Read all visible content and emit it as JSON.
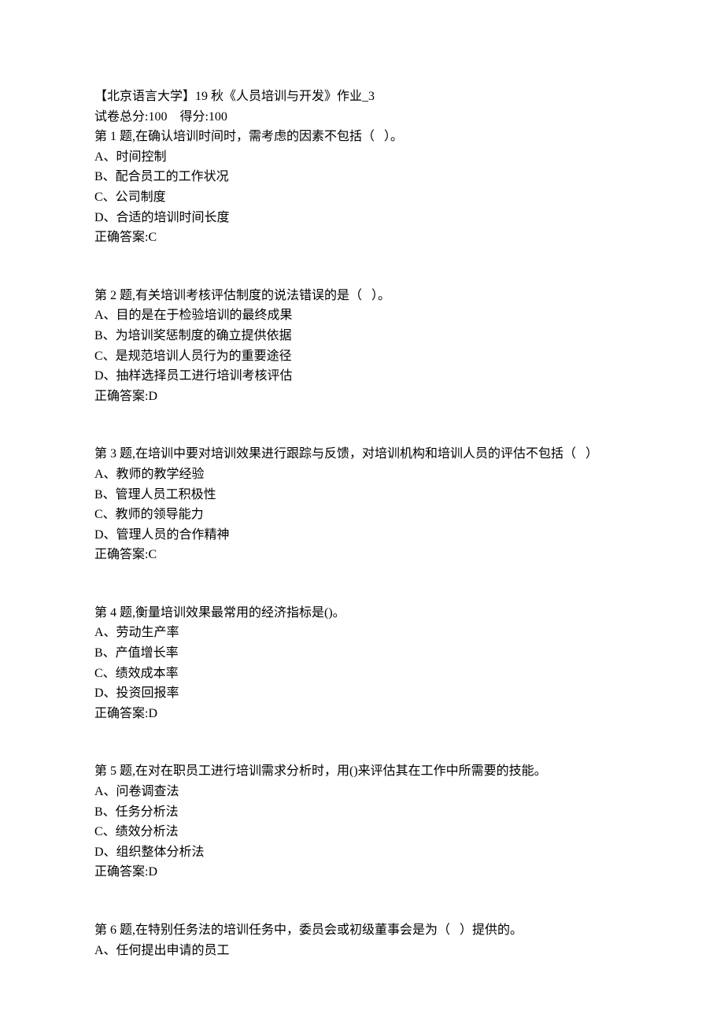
{
  "header": {
    "title_line": "【北京语言大学】19 秋《人员培训与开发》作业_3",
    "score_line": "试卷总分:100    得分:100"
  },
  "questions": [
    {
      "stem": "第 1 题,在确认培训时间时，需考虑的因素不包括（   ）。",
      "options": [
        "A、时间控制",
        "B、配合员工的工作状况",
        "C、公司制度",
        "D、合适的培训时间长度"
      ],
      "answer": "正确答案:C"
    },
    {
      "stem": "第 2 题,有关培训考核评估制度的说法错误的是（   ）。",
      "options": [
        "A、目的是在于检验培训的最终成果",
        "B、为培训奖惩制度的确立提供依据",
        "C、是规范培训人员行为的重要途径",
        "D、抽样选择员工进行培训考核评估"
      ],
      "answer": "正确答案:D"
    },
    {
      "stem": "第 3 题,在培训中要对培训效果进行跟踪与反馈，对培训机构和培训人员的评估不包括（   ）",
      "options": [
        "A、教师的教学经验",
        "B、管理人员工积极性",
        "C、教师的领导能力",
        "D、管理人员的合作精神"
      ],
      "answer": "正确答案:C"
    },
    {
      "stem": "第 4 题,衡量培训效果最常用的经济指标是()。",
      "options": [
        "A、劳动生产率",
        "B、产值增长率",
        "C、绩效成本率",
        "D、投资回报率"
      ],
      "answer": "正确答案:D"
    },
    {
      "stem": "第 5 题,在对在职员工进行培训需求分析时，用()来评估其在工作中所需要的技能。",
      "options": [
        "A、问卷调查法",
        "B、任务分析法",
        "C、绩效分析法",
        "D、组织整体分析法"
      ],
      "answer": "正确答案:D"
    },
    {
      "stem": "第 6 题,在特别任务法的培训任务中，委员会或初级董事会是为（   ）提供的。",
      "options": [
        "A、任何提出申请的员工"
      ],
      "answer": ""
    }
  ]
}
